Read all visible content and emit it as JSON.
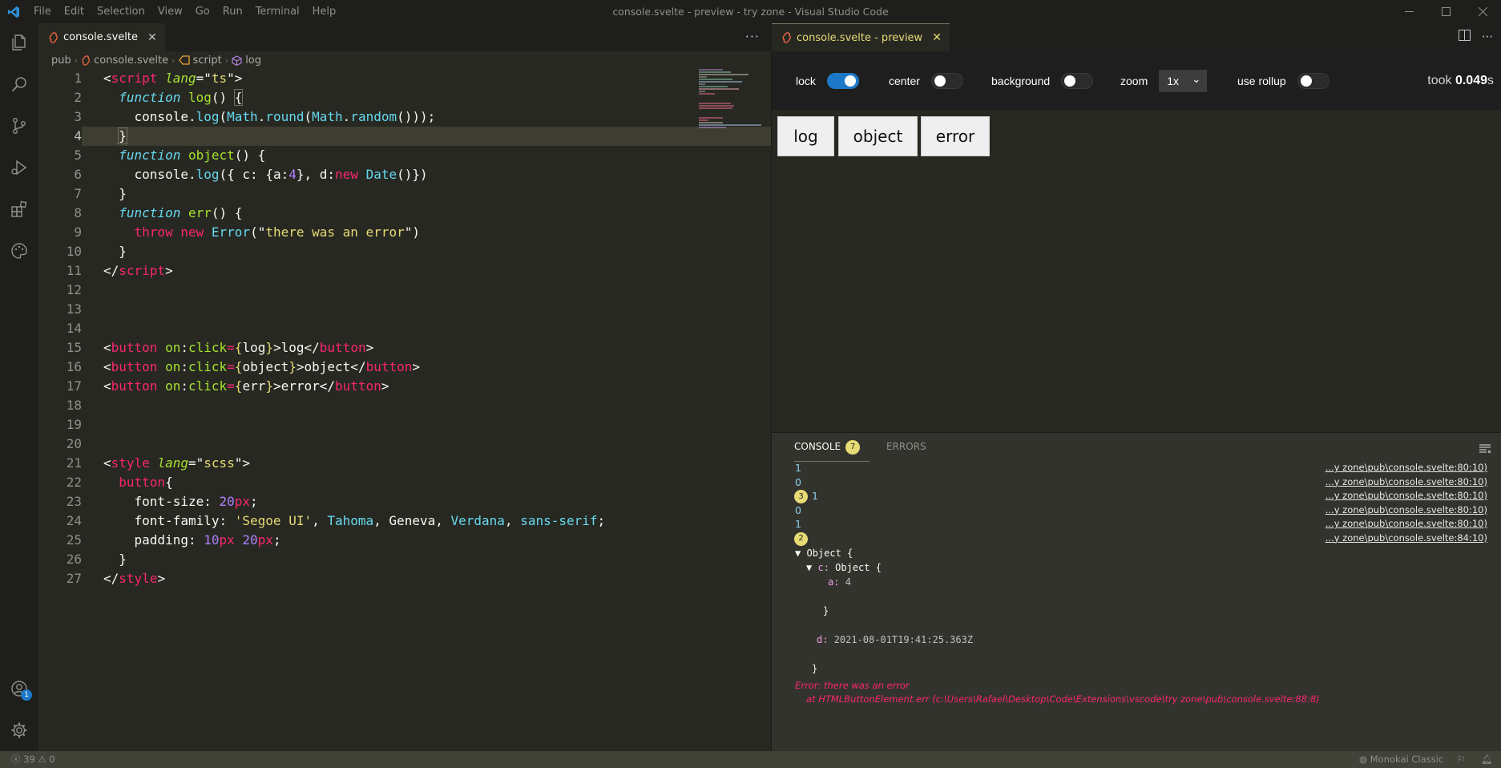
{
  "app": {
    "window_title": "console.svelte - preview - try zone - Visual Studio Code",
    "menu": [
      "File",
      "Edit",
      "Selection",
      "View",
      "Go",
      "Run",
      "Terminal",
      "Help"
    ]
  },
  "editor": {
    "tab_label": "console.svelte",
    "breadcrumb": [
      "pub",
      "console.svelte",
      "script",
      "log"
    ],
    "current_line": 4,
    "lines": [
      {
        "n": "1"
      },
      {
        "n": "2"
      },
      {
        "n": "3"
      },
      {
        "n": "4"
      },
      {
        "n": "5"
      },
      {
        "n": "6"
      },
      {
        "n": "7"
      },
      {
        "n": "8"
      },
      {
        "n": "9"
      },
      {
        "n": "10"
      },
      {
        "n": "11"
      },
      {
        "n": "12"
      },
      {
        "n": "13"
      },
      {
        "n": "14"
      },
      {
        "n": "15"
      },
      {
        "n": "16"
      },
      {
        "n": "17"
      },
      {
        "n": "18"
      },
      {
        "n": "19"
      },
      {
        "n": "20"
      },
      {
        "n": "21"
      },
      {
        "n": "22"
      },
      {
        "n": "23"
      },
      {
        "n": "24"
      },
      {
        "n": "25"
      },
      {
        "n": "26"
      },
      {
        "n": "27"
      }
    ],
    "code": {
      "l1": [
        "<",
        "script",
        " ",
        "lang",
        "=\"",
        "ts",
        "\">"
      ],
      "l2": [
        "function",
        " ",
        "log",
        "() ",
        "{"
      ],
      "l3": [
        "console",
        ".",
        "log",
        "(",
        "Math",
        ".",
        "round",
        "(",
        "Math",
        ".",
        "random",
        "()));"
      ],
      "l4": [
        "}"
      ],
      "l5": [
        "function",
        " ",
        "object",
        "() {"
      ],
      "l6": [
        "console",
        ".",
        "log",
        "({ c: {",
        "a",
        ":",
        "4",
        "}, d:",
        "new",
        " ",
        "Date",
        "()})"
      ],
      "l7": [
        "}"
      ],
      "l8": [
        "function",
        " ",
        "err",
        "() {"
      ],
      "l9": [
        "throw",
        " ",
        "new",
        " ",
        "Error",
        "(\"",
        "there was an error",
        "\")"
      ],
      "l10": [
        "}"
      ],
      "l11": [
        "</",
        "script",
        ">"
      ],
      "l15": [
        "<",
        "button",
        " ",
        "on",
        ":",
        "click",
        "=",
        "{",
        "log",
        "}",
        ">log</",
        "button",
        ">"
      ],
      "l16": [
        "<",
        "button",
        " ",
        "on",
        ":",
        "click",
        "=",
        "{",
        "object",
        "}",
        ">object</",
        "button",
        ">"
      ],
      "l17": [
        "<",
        "button",
        " ",
        "on",
        ":",
        "click",
        "=",
        "{",
        "err",
        "}",
        ">error</",
        "button",
        ">"
      ],
      "l21": [
        "<",
        "style",
        " ",
        "lang",
        "=\"",
        "scss",
        "\">"
      ],
      "l22": [
        "button",
        "{"
      ],
      "l23": [
        "font-size",
        ": ",
        "20",
        "px",
        ";"
      ],
      "l24": [
        "font-family",
        ": ",
        "'Segoe UI'",
        ", ",
        "Tahoma",
        ", ",
        "Geneva",
        ", ",
        "Verdana",
        ", ",
        "sans-serif",
        ";"
      ],
      "l25": [
        "padding",
        ": ",
        "10",
        "px",
        " ",
        "20",
        "px",
        ";"
      ],
      "l26": [
        "}"
      ],
      "l27": [
        "</",
        "style",
        ">"
      ]
    }
  },
  "preview": {
    "tab_label": "console.svelte - preview",
    "toolbar": {
      "lock_label": "lock",
      "lock_on": true,
      "center_label": "center",
      "center_on": false,
      "background_label": "background",
      "background_on": false,
      "zoom_label": "zoom",
      "zoom_value": "1x",
      "rollup_label": "use rollup",
      "rollup_on": false,
      "took_label": "took",
      "took_value": "0.049",
      "took_unit": "s"
    },
    "buttons": [
      "log",
      "object",
      "error"
    ]
  },
  "console": {
    "tab_console": "CONSOLE",
    "tab_console_count": "7",
    "tab_errors": "ERRORS",
    "entries": [
      {
        "text": "1",
        "source": "...y zone\\pub\\console.svelte:80:10)"
      },
      {
        "text": "0",
        "source": "...y zone\\pub\\console.svelte:80:10)"
      },
      {
        "repeat": "3",
        "text": "1",
        "source": "...y zone\\pub\\console.svelte:80:10)"
      },
      {
        "text": "0",
        "source": "...y zone\\pub\\console.svelte:80:10)"
      },
      {
        "text": "1",
        "source": "...y zone\\pub\\console.svelte:80:10)"
      },
      {
        "repeat": "2",
        "text": "",
        "source": "...y zone\\pub\\console.svelte:84:10)"
      }
    ],
    "object_tree": {
      "root": "Object {",
      "c_key": "c:",
      "c_val": "Object {",
      "a_key": "a:",
      "a_val": "4",
      "c_close": "}",
      "d_key": "d:",
      "d_val": "2021-08-01T19:41:25.363Z",
      "root_close": "}"
    },
    "error_line1": "Error: there was an error",
    "error_line2": "at HTMLButtonElement.err (c:\\Users\\Rafael\\Desktop\\Code\\Extensions\\vscode\\try zone\\pub\\console.svelte:88:8)"
  },
  "statusbar": {
    "errors": "39",
    "warnings": "0",
    "theme": "Monokai Classic"
  },
  "colors": {
    "editor_bg": "#272822",
    "activity_bg": "#1e1f1c",
    "accent_blue": "#1e78c8",
    "keyword_pink": "#f92672",
    "string_yellow": "#e6db74",
    "function_green": "#a6e22e",
    "type_cyan": "#66d9ef"
  }
}
